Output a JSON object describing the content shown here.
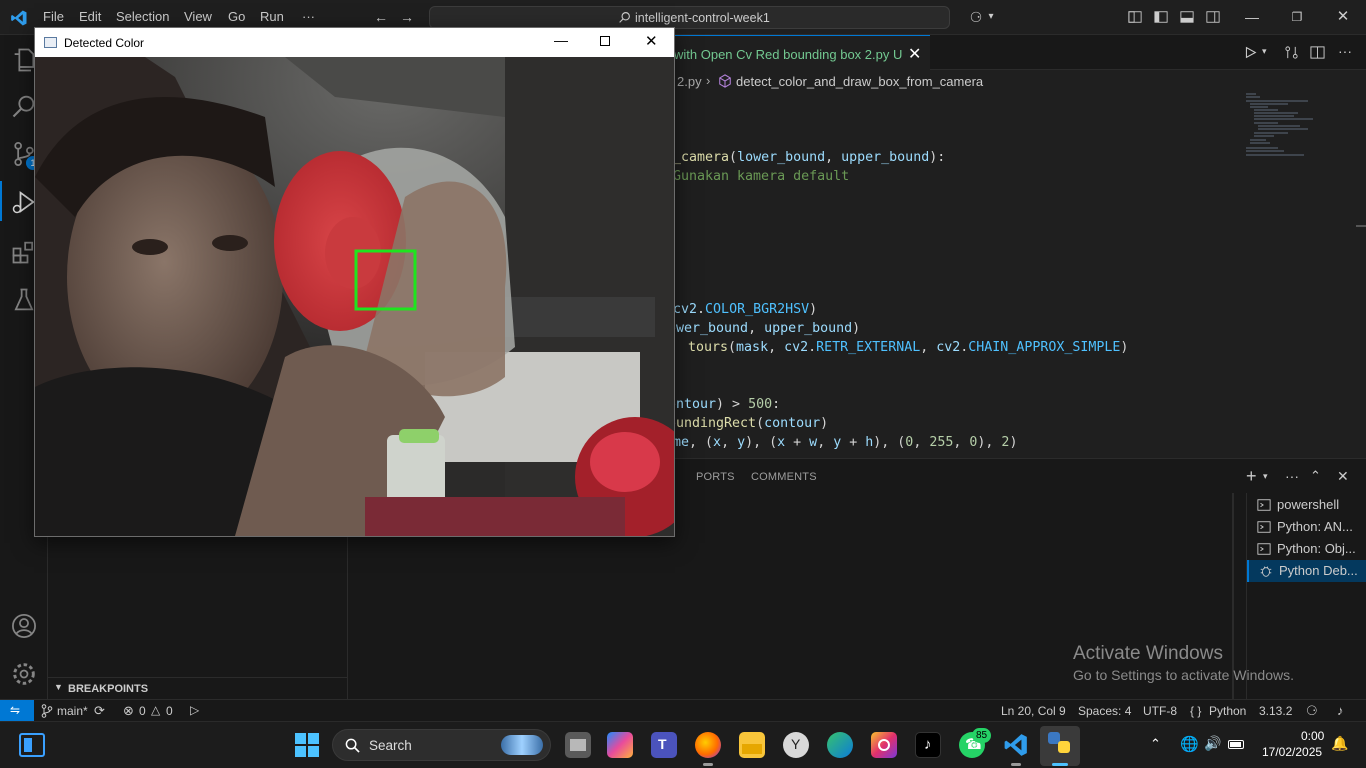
{
  "titlebar": {
    "menu": [
      "File",
      "Edit",
      "Selection",
      "View",
      "Go",
      "Run",
      "···"
    ],
    "command_center": "intelligent-control-week1"
  },
  "activity": {
    "scm_badge": "1"
  },
  "editor": {
    "tab_label": "with Open Cv Red bounding box 2.py",
    "tab_status": "U",
    "breadcrumb_file": "2.py",
    "breadcrumb_symbol": "detect_color_and_draw_box_from_camera",
    "lines": [
      {
        "parts": [
          [
            "_camera",
            "kw-fn"
          ],
          [
            "(",
            "kw-plain"
          ],
          [
            "lower_bound",
            "kw-var"
          ],
          [
            ", ",
            "kw-plain"
          ],
          [
            "upper_bound",
            "kw-var"
          ],
          [
            "):",
            "kw-plain"
          ]
        ]
      },
      {
        "parts": [
          [
            "Gunakan kamera default",
            "kw-cmt"
          ]
        ]
      },
      {
        "parts": [
          [
            "cv2",
            "kw-var"
          ],
          [
            ".",
            "kw-plain"
          ],
          [
            "COLOR_BGR2HSV",
            "kw-const"
          ],
          [
            ")",
            "kw-plain"
          ]
        ]
      },
      {
        "parts": [
          [
            "ower_bound",
            "kw-var"
          ],
          [
            ", ",
            "kw-plain"
          ],
          [
            "upper_bound",
            "kw-var"
          ],
          [
            ")",
            "kw-plain"
          ]
        ]
      },
      {
        "parts": [
          [
            "tours",
            "kw-fn"
          ],
          [
            "(",
            "kw-plain"
          ],
          [
            "mask",
            "kw-var"
          ],
          [
            ", ",
            "kw-plain"
          ],
          [
            "cv2",
            "kw-var"
          ],
          [
            ".",
            "kw-plain"
          ],
          [
            "RETR_EXTERNAL",
            "kw-const"
          ],
          [
            ", ",
            "kw-plain"
          ],
          [
            "cv2",
            "kw-var"
          ],
          [
            ".",
            "kw-plain"
          ],
          [
            "CHAIN_APPROX_SIMPLE",
            "kw-const"
          ],
          [
            ")",
            "kw-plain"
          ]
        ]
      },
      {
        "parts": [
          [
            "ontour",
            "kw-var"
          ],
          [
            ") > ",
            "kw-plain"
          ],
          [
            "500",
            "kw-num"
          ],
          [
            ":",
            "kw-plain"
          ]
        ]
      },
      {
        "parts": [
          [
            "oundingRect",
            "kw-fn"
          ],
          [
            "(",
            "kw-plain"
          ],
          [
            "contour",
            "kw-var"
          ],
          [
            ")",
            "kw-plain"
          ]
        ]
      },
      {
        "parts": [
          [
            "me",
            "kw-var"
          ],
          [
            ", (",
            "kw-plain"
          ],
          [
            "x",
            "kw-var"
          ],
          [
            ", ",
            "kw-plain"
          ],
          [
            "y",
            "kw-var"
          ],
          [
            "), (",
            "kw-plain"
          ],
          [
            "x",
            "kw-var"
          ],
          [
            " + ",
            "kw-plain"
          ],
          [
            "w",
            "kw-var"
          ],
          [
            ", ",
            "kw-plain"
          ],
          [
            "y",
            "kw-var"
          ],
          [
            " + ",
            "kw-plain"
          ],
          [
            "h",
            "kw-var"
          ],
          [
            "), (",
            "kw-plain"
          ],
          [
            "0",
            "kw-num"
          ],
          [
            ", ",
            "kw-plain"
          ],
          [
            "255",
            "kw-num"
          ],
          [
            ", ",
            "kw-plain"
          ],
          [
            "0",
            "kw-num"
          ],
          [
            "), ",
            "kw-plain"
          ],
          [
            "2",
            "kw-num"
          ],
          [
            ")",
            "kw-plain"
          ]
        ]
      }
    ]
  },
  "panel": {
    "tabs": [
      "PORTS",
      "COMMENTS"
    ],
    "terminals": [
      "powershell",
      "Python: AN...",
      "Python: Obj...",
      "Python Deb..."
    ]
  },
  "sidebar": {
    "breakpoints_label": "BREAKPOINTS"
  },
  "watermark": {
    "line1": "Activate Windows",
    "line2": "Go to Settings to activate Windows."
  },
  "statusbar": {
    "branch": "main*",
    "errors": "0",
    "warnings": "0",
    "position": "Ln 20, Col 9",
    "spaces": "Spaces: 4",
    "encoding": "UTF-8",
    "braces": "{ }",
    "language": "Python",
    "version": "3.13.2"
  },
  "cv_window": {
    "title": "Detected Color"
  },
  "taskbar": {
    "search": "Search",
    "whatsapp_badge": "85",
    "time": "0:00",
    "date": "17/02/2025"
  },
  "colors": {
    "accent": "#0078d4",
    "box": "#1ee51e"
  }
}
